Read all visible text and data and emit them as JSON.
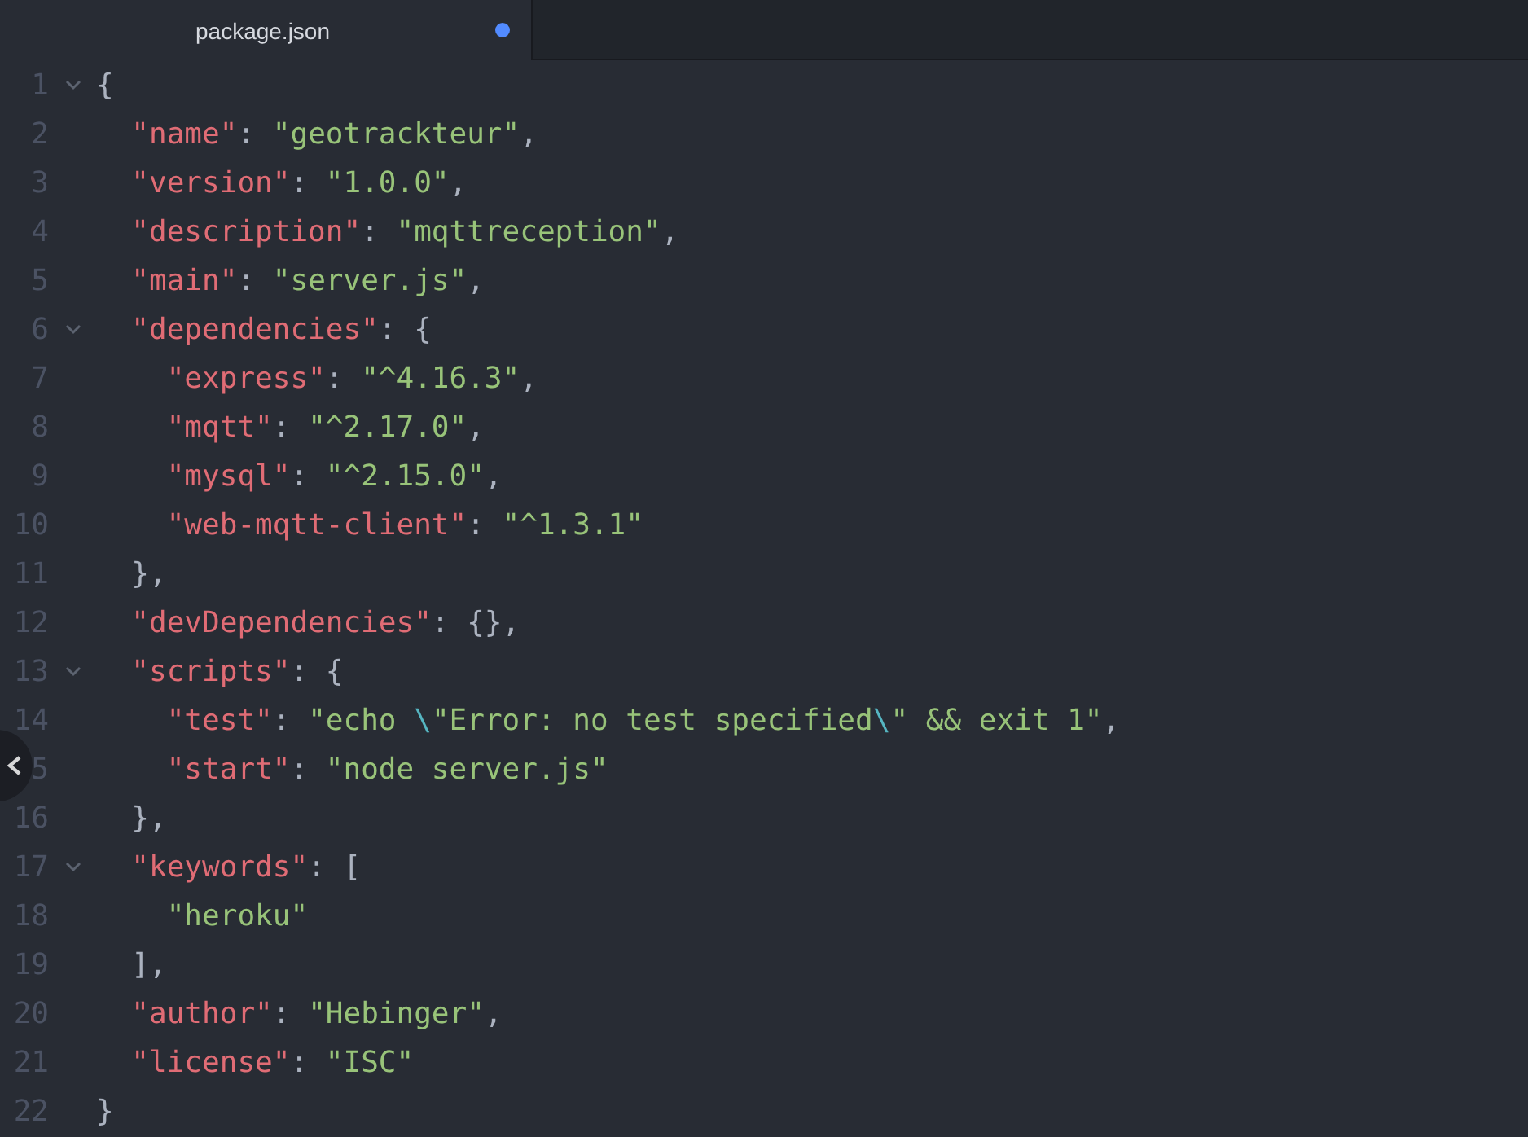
{
  "tab": {
    "title": "package.json",
    "modified": true
  },
  "lines": [
    {
      "number": "1",
      "foldable": true,
      "tokens": [
        {
          "kind": "punct",
          "text": "{"
        }
      ]
    },
    {
      "number": "2",
      "foldable": false,
      "tokens": [
        {
          "kind": "key",
          "text": "  \"name\""
        },
        {
          "kind": "punct",
          "text": ": "
        },
        {
          "kind": "string",
          "text": "\"geotrackteur\""
        },
        {
          "kind": "punct",
          "text": ","
        }
      ]
    },
    {
      "number": "3",
      "foldable": false,
      "tokens": [
        {
          "kind": "key",
          "text": "  \"version\""
        },
        {
          "kind": "punct",
          "text": ": "
        },
        {
          "kind": "string",
          "text": "\"1.0.0\""
        },
        {
          "kind": "punct",
          "text": ","
        }
      ]
    },
    {
      "number": "4",
      "foldable": false,
      "tokens": [
        {
          "kind": "key",
          "text": "  \"description\""
        },
        {
          "kind": "punct",
          "text": ": "
        },
        {
          "kind": "string",
          "text": "\"mqttreception\""
        },
        {
          "kind": "punct",
          "text": ","
        }
      ]
    },
    {
      "number": "5",
      "foldable": false,
      "tokens": [
        {
          "kind": "key",
          "text": "  \"main\""
        },
        {
          "kind": "punct",
          "text": ": "
        },
        {
          "kind": "string",
          "text": "\"server.js\""
        },
        {
          "kind": "punct",
          "text": ","
        }
      ]
    },
    {
      "number": "6",
      "foldable": true,
      "tokens": [
        {
          "kind": "key",
          "text": "  \"dependencies\""
        },
        {
          "kind": "punct",
          "text": ": {"
        }
      ]
    },
    {
      "number": "7",
      "foldable": false,
      "tokens": [
        {
          "kind": "key",
          "text": "    \"express\""
        },
        {
          "kind": "punct",
          "text": ": "
        },
        {
          "kind": "string",
          "text": "\"^4.16.3\""
        },
        {
          "kind": "punct",
          "text": ","
        }
      ]
    },
    {
      "number": "8",
      "foldable": false,
      "tokens": [
        {
          "kind": "key",
          "text": "    \"mqtt\""
        },
        {
          "kind": "punct",
          "text": ": "
        },
        {
          "kind": "string",
          "text": "\"^2.17.0\""
        },
        {
          "kind": "punct",
          "text": ","
        }
      ]
    },
    {
      "number": "9",
      "foldable": false,
      "tokens": [
        {
          "kind": "key",
          "text": "    \"mysql\""
        },
        {
          "kind": "punct",
          "text": ": "
        },
        {
          "kind": "string",
          "text": "\"^2.15.0\""
        },
        {
          "kind": "punct",
          "text": ","
        }
      ]
    },
    {
      "number": "10",
      "foldable": false,
      "tokens": [
        {
          "kind": "key",
          "text": "    \"web-mqtt-client\""
        },
        {
          "kind": "punct",
          "text": ": "
        },
        {
          "kind": "string",
          "text": "\"^1.3.1\""
        }
      ]
    },
    {
      "number": "11",
      "foldable": false,
      "tokens": [
        {
          "kind": "punct",
          "text": "  },"
        }
      ]
    },
    {
      "number": "12",
      "foldable": false,
      "tokens": [
        {
          "kind": "key",
          "text": "  \"devDependencies\""
        },
        {
          "kind": "punct",
          "text": ": {},"
        }
      ]
    },
    {
      "number": "13",
      "foldable": true,
      "tokens": [
        {
          "kind": "key",
          "text": "  \"scripts\""
        },
        {
          "kind": "punct",
          "text": ": {"
        }
      ]
    },
    {
      "number": "14",
      "foldable": false,
      "tokens": [
        {
          "kind": "key",
          "text": "    \"test\""
        },
        {
          "kind": "punct",
          "text": ": "
        },
        {
          "kind": "string",
          "text": "\"echo "
        },
        {
          "kind": "escape",
          "text": "\\"
        },
        {
          "kind": "string",
          "text": "\"Error: no test specified"
        },
        {
          "kind": "escape",
          "text": "\\"
        },
        {
          "kind": "string",
          "text": "\" && exit 1\""
        },
        {
          "kind": "punct",
          "text": ","
        }
      ]
    },
    {
      "number": "5",
      "foldable": false,
      "tokens": [
        {
          "kind": "key",
          "text": "    \"start\""
        },
        {
          "kind": "punct",
          "text": ": "
        },
        {
          "kind": "string",
          "text": "\"node server.js\""
        }
      ]
    },
    {
      "number": "16",
      "foldable": false,
      "tokens": [
        {
          "kind": "punct",
          "text": "  },"
        }
      ]
    },
    {
      "number": "17",
      "foldable": true,
      "tokens": [
        {
          "kind": "key",
          "text": "  \"keywords\""
        },
        {
          "kind": "punct",
          "text": ": ["
        }
      ]
    },
    {
      "number": "18",
      "foldable": false,
      "tokens": [
        {
          "kind": "string",
          "text": "    \"heroku\""
        }
      ]
    },
    {
      "number": "19",
      "foldable": false,
      "tokens": [
        {
          "kind": "punct",
          "text": "  ],"
        }
      ]
    },
    {
      "number": "20",
      "foldable": false,
      "tokens": [
        {
          "kind": "key",
          "text": "  \"author\""
        },
        {
          "kind": "punct",
          "text": ": "
        },
        {
          "kind": "string",
          "text": "\"Hebinger\""
        },
        {
          "kind": "punct",
          "text": ","
        }
      ]
    },
    {
      "number": "21",
      "foldable": false,
      "tokens": [
        {
          "kind": "key",
          "text": "  \"license\""
        },
        {
          "kind": "punct",
          "text": ": "
        },
        {
          "kind": "string",
          "text": "\"ISC\""
        }
      ]
    },
    {
      "number": "22",
      "foldable": false,
      "tokens": [
        {
          "kind": "punct",
          "text": "}"
        }
      ]
    }
  ]
}
